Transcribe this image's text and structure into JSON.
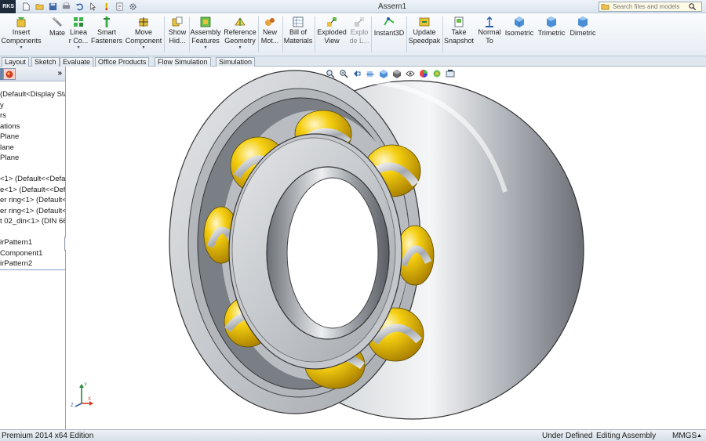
{
  "app": {
    "logo_text": "RKS",
    "window_title": "Assem1"
  },
  "search": {
    "placeholder": "Search files and models"
  },
  "ribbon": {
    "commands": [
      {
        "id": "insert-components",
        "line1": "Insert",
        "line2": "Components",
        "arrow": "▾",
        "icon": "insert-components-icon"
      },
      {
        "id": "mate",
        "line1": "Mate",
        "line2": "",
        "icon": "mate-icon"
      },
      {
        "id": "linear-pattern",
        "line1": "Linea",
        "line2": "r Co...",
        "arrow": "▾",
        "icon": "linear-pattern-icon"
      },
      {
        "id": "smart-fasteners",
        "line1": "Smart",
        "line2": "Fasteners",
        "icon": "smart-fasteners-icon"
      },
      {
        "id": "move-component",
        "line1": "Move",
        "line2": "Component",
        "arrow": "▾",
        "icon": "move-component-icon"
      },
      {
        "id": "show-hidden",
        "line1": "Show",
        "line2": "Hid...",
        "icon": "show-hidden-icon"
      },
      {
        "id": "assembly-features",
        "line1": "Assembly",
        "line2": "Features",
        "arrow": "▾",
        "icon": "assembly-features-icon"
      },
      {
        "id": "reference-geometry",
        "line1": "Reference",
        "line2": "Geometry",
        "arrow": "▾",
        "icon": "reference-geometry-icon"
      },
      {
        "id": "new-motion",
        "line1": "New",
        "line2": "Mot...",
        "icon": "new-motion-icon"
      },
      {
        "id": "bill-of-materials",
        "line1": "Bill of",
        "line2": "Materials",
        "icon": "bill-of-materials-icon"
      },
      {
        "id": "exploded-view",
        "line1": "Exploded",
        "line2": "View",
        "icon": "exploded-view-icon"
      },
      {
        "id": "explode-line",
        "line1": "Explo",
        "line2": "de L...",
        "icon": "explode-line-icon",
        "disabled": true
      },
      {
        "id": "instant3d",
        "line1": "Instant3D",
        "line2": "",
        "icon": "instant3d-icon"
      },
      {
        "id": "update-speedpak",
        "line1": "Update",
        "line2": "Speedpak",
        "icon": "update-speedpak-icon"
      },
      {
        "id": "take-snapshot",
        "line1": "Take",
        "line2": "Snapshot",
        "icon": "take-snapshot-icon"
      },
      {
        "id": "normal-to",
        "line1": "Normal",
        "line2": "To",
        "icon": "normal-to-icon"
      },
      {
        "id": "isometric",
        "line1": "Isometric",
        "line2": "",
        "icon": "isometric-icon"
      },
      {
        "id": "trimetric",
        "line1": "Trimetric",
        "line2": "",
        "icon": "trimetric-icon"
      },
      {
        "id": "dimetric",
        "line1": "Dimetric",
        "line2": "",
        "icon": "dimetric-icon"
      }
    ]
  },
  "tabs": [
    "Layout",
    "Sketch",
    "Evaluate",
    "Office Products",
    "Flow Simulation",
    "Simulation"
  ],
  "tree": {
    "collapse_glyph": "»",
    "items": [
      "(Default<Display Sta",
      "y",
      "rs",
      "ations",
      "Plane",
      "lane",
      "Plane",
      "",
      "<1> (Default<<Defa",
      "e<1> (Default<<Def",
      "er ring<1> (Default<",
      "er ring<1> (Default<",
      "t 02_din<1> (DIN 66",
      "",
      "irPattern1",
      "Component1",
      "irPattern2"
    ]
  },
  "triad": {
    "x_label": "X",
    "y_label": "Y",
    "z_label": "Z"
  },
  "status": {
    "edition": "Premium 2014 x64 Edition",
    "state": "Under Defined",
    "mode": "Editing Assembly",
    "units": "MMGS",
    "units_arrow": "▲"
  },
  "colors": {
    "ball": "#f2c200",
    "steel": "#b9bdc2",
    "accent": "#2f6db5"
  }
}
